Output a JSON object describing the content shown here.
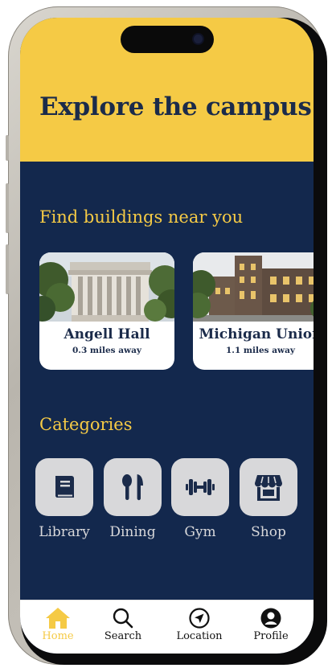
{
  "header": {
    "title": "Explore the campus"
  },
  "nearby": {
    "title": "Find buildings near you",
    "cards": [
      {
        "name": "Angell Hall",
        "distance": "0.3 miles away"
      },
      {
        "name": "Michigan Union",
        "distance": "1.1 miles away"
      }
    ]
  },
  "categories": {
    "title": "Categories",
    "items": [
      {
        "label": "Library",
        "icon": "book-icon"
      },
      {
        "label": "Dining",
        "icon": "utensils-icon"
      },
      {
        "label": "Gym",
        "icon": "dumbbell-icon"
      },
      {
        "label": "Shop",
        "icon": "store-icon"
      }
    ]
  },
  "tabbar": {
    "items": [
      {
        "label": "Home",
        "icon": "home-icon",
        "active": true
      },
      {
        "label": "Search",
        "icon": "search-icon",
        "active": false
      },
      {
        "label": "Location",
        "icon": "location-arrow-icon",
        "active": false
      },
      {
        "label": "Profile",
        "icon": "profile-icon",
        "active": false
      }
    ]
  },
  "colors": {
    "maize": "#f5ca45",
    "navy": "#13284d",
    "tile": "#d8d8da"
  }
}
